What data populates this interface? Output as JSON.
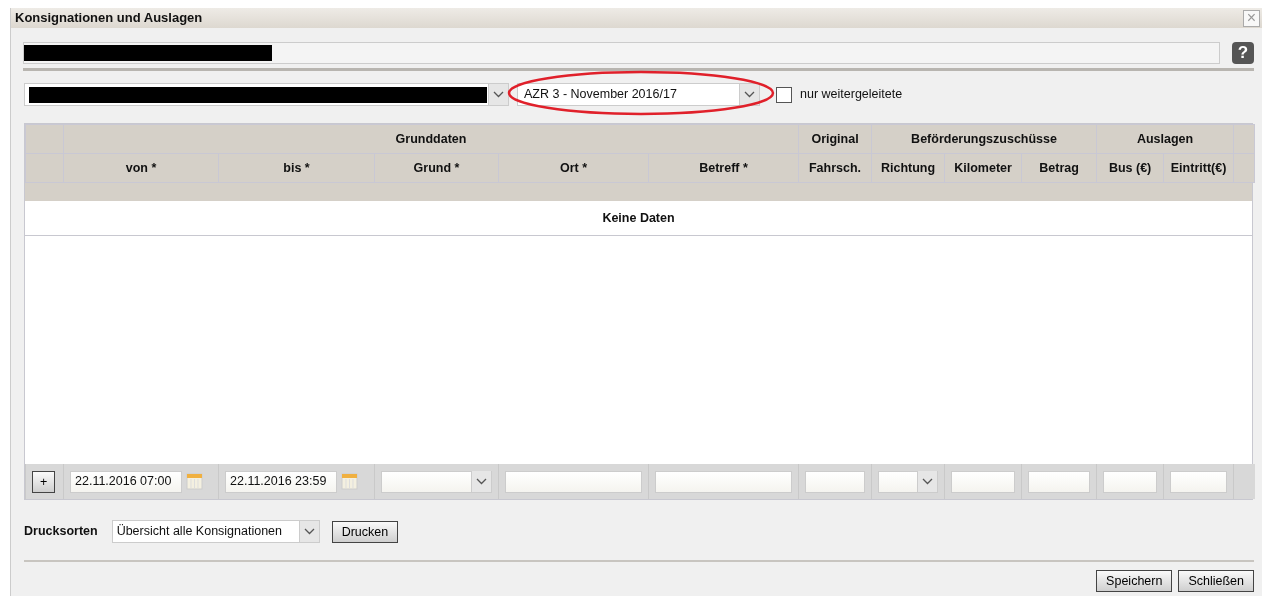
{
  "window": {
    "title": "Konsignationen und Auslagen",
    "close": "×"
  },
  "help_button": "?",
  "period_select": {
    "value": "AZR 3 - November 2016/17",
    "highlighted": true
  },
  "forwarded_only": {
    "label": "nur weitergeleitete",
    "checked": false
  },
  "table": {
    "column_groups": [
      {
        "label": "Grunddaten",
        "columns": [
          "von *",
          "bis *",
          "Grund *",
          "Ort *",
          "Betreff *"
        ]
      },
      {
        "label": "Original",
        "columns": [
          "Fahrsch."
        ]
      },
      {
        "label": "Beförderungszuschüsse",
        "columns": [
          "Richtung",
          "Kilometer",
          "Betrag"
        ]
      },
      {
        "label": "Auslagen",
        "columns": [
          "Bus (€)",
          "Eintritt(€)"
        ]
      }
    ],
    "empty_message": "Keine Daten",
    "add_button": "+",
    "new_row": [
      {
        "kind": "datetime",
        "value": "22.11.2016 07:00"
      },
      {
        "kind": "datetime",
        "value": "22.11.2016 23:59"
      },
      {
        "kind": "select"
      },
      {
        "kind": "text"
      },
      {
        "kind": "text"
      },
      {
        "kind": "text"
      },
      {
        "kind": "select"
      },
      {
        "kind": "text"
      },
      {
        "kind": "text"
      },
      {
        "kind": "text"
      },
      {
        "kind": "text"
      }
    ]
  },
  "print": {
    "label": "Drucksorten",
    "value": "Übersicht alle Konsignationen",
    "button": "Drucken"
  },
  "buttons": [
    "Speichern",
    "Schließen"
  ]
}
